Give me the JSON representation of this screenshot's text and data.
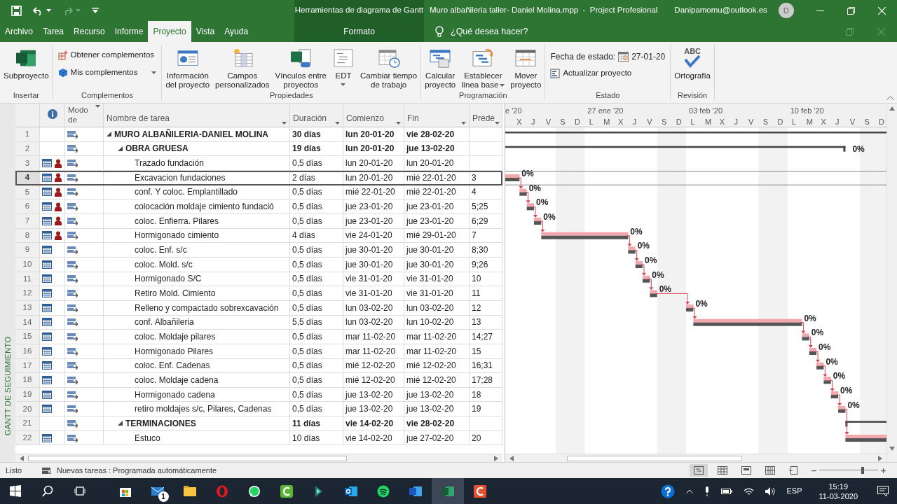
{
  "title_bar": {
    "contextual_title": "Herramientas de diagrama de Gantt",
    "document_title": "Muro albañileria taller- Daniel Molina.mpp  -  Project Profesional",
    "account": "Danipamomu@outlook.es",
    "avatar_initial": "D"
  },
  "ribbon_tabs": [
    {
      "label": "Archivo",
      "selected": false,
      "kind": "normal"
    },
    {
      "label": "Tarea",
      "selected": false,
      "kind": "normal"
    },
    {
      "label": "Recurso",
      "selected": false,
      "kind": "normal"
    },
    {
      "label": "Informe",
      "selected": false,
      "kind": "normal"
    },
    {
      "label": "Proyecto",
      "selected": true,
      "kind": "normal"
    },
    {
      "label": "Vista",
      "selected": false,
      "kind": "normal"
    },
    {
      "label": "Ayuda",
      "selected": false,
      "kind": "normal"
    },
    {
      "label": "Formato",
      "selected": false,
      "kind": "contextual"
    }
  ],
  "tell_me": {
    "placeholder": "¿Qué desea hacer?"
  },
  "ribbon_groups": [
    {
      "label": "Insertar",
      "controls": [
        {
          "kind": "large",
          "label": "Subproyecto",
          "dropdown": false
        }
      ]
    },
    {
      "label": "Complementos",
      "controls": [
        {
          "kind": "small",
          "label": "Obtener complementos",
          "dropdown": false
        },
        {
          "kind": "small",
          "label": "Mis complementos",
          "dropdown": true
        }
      ]
    },
    {
      "label": "Propiedades",
      "controls": [
        {
          "kind": "large",
          "label": "Información\ndel proyecto",
          "dropdown": false
        },
        {
          "kind": "large",
          "label": "Campos\npersonalizados",
          "dropdown": false
        },
        {
          "kind": "large",
          "label": "Vínculos entre\nproyectos",
          "dropdown": false
        },
        {
          "kind": "large",
          "label": "EDT",
          "dropdown": true
        },
        {
          "kind": "large",
          "label": "Cambiar tiempo\nde trabajo",
          "dropdown": false
        }
      ]
    },
    {
      "label": "Programación",
      "controls": [
        {
          "kind": "large",
          "label": "Calcular\nproyecto",
          "dropdown": false
        },
        {
          "kind": "large",
          "label": "Establecer\nlínea base",
          "dropdown": true
        },
        {
          "kind": "large",
          "label": "Mover\nproyecto",
          "dropdown": false
        }
      ]
    },
    {
      "label": "Estado",
      "controls": [
        {
          "kind": "date",
          "label": "Fecha de estado:",
          "value": "27-01-20"
        },
        {
          "kind": "small",
          "label": "Actualizar proyecto",
          "dropdown": false
        }
      ]
    },
    {
      "label": "Revisión",
      "controls": [
        {
          "kind": "large",
          "label": "Ortografía",
          "icon_text": "ABC",
          "dropdown": false
        }
      ]
    }
  ],
  "side_label": "GANTT DE SEGUIMIENTO",
  "table": {
    "columns": [
      {
        "label": "Modo de"
      },
      {
        "label": "Nombre de tarea"
      },
      {
        "label": "Duración"
      },
      {
        "label": "Comienzo"
      },
      {
        "label": "Fin"
      },
      {
        "label": "Prede"
      }
    ],
    "tasks": [
      {
        "id": "1",
        "name": "MURO ALBAÑILERIA-DANIEL MOLINA",
        "duration": "30 días",
        "start": "lun 20-01-20",
        "finish": "vie 28-02-20",
        "calendar_icon": false,
        "person_icon": false,
        "selected": false,
        "expanded": true,
        "children": [
          {
            "id": "2",
            "name": "OBRA GRUESA",
            "duration": "19 días",
            "start": "lun 20-01-20",
            "finish": "jue 13-02-20",
            "percent": "0%",
            "calendar_icon": false,
            "person_icon": false,
            "selected": false,
            "expanded": true,
            "children": [
              {
                "id": "3",
                "name": "Trazado fundación",
                "duration": "0,5 días",
                "start": "lun 20-01-20",
                "finish": "lun 20-01-20",
                "calendar_icon": true,
                "person_icon": true,
                "selected": false
              },
              {
                "id": "4",
                "name": "Excavacion fundaciones",
                "duration": "2 días",
                "start": "lun 20-01-20",
                "finish": "mié 22-01-20",
                "predecessors": "3",
                "percent": "0%",
                "calendar_icon": true,
                "person_icon": true,
                "selected": true
              },
              {
                "id": "5",
                "name": "conf. Y coloc. Emplantillado",
                "duration": "0,5 días",
                "start": "mié 22-01-20",
                "finish": "mié 22-01-20",
                "predecessors": "4",
                "percent": "0%",
                "calendar_icon": true,
                "person_icon": true,
                "selected": false
              },
              {
                "id": "6",
                "name": "colocación moldaje cimiento fundació",
                "duration": "0,5 días",
                "start": "jue 23-01-20",
                "finish": "jue 23-01-20",
                "predecessors": "5;25",
                "percent": "0%",
                "calendar_icon": true,
                "person_icon": true,
                "selected": false
              },
              {
                "id": "7",
                "name": "coloc. Enfierra. Pilares",
                "duration": "0,5 días",
                "start": "jue 23-01-20",
                "finish": "jue 23-01-20",
                "predecessors": "6;29",
                "percent": "0%",
                "calendar_icon": true,
                "person_icon": true,
                "selected": false
              },
              {
                "id": "8",
                "name": "Hormigonado cimiento",
                "duration": "4 días",
                "start": "vie 24-01-20",
                "finish": "mié 29-01-20",
                "predecessors": "7",
                "percent": "0%",
                "calendar_icon": true,
                "person_icon": true,
                "selected": false
              },
              {
                "id": "9",
                "name": "coloc. Enf. s/c",
                "duration": "0,5 días",
                "start": "jue 30-01-20",
                "finish": "jue 30-01-20",
                "predecessors": "8;30",
                "percent": "0%",
                "calendar_icon": true,
                "person_icon": false,
                "selected": false
              },
              {
                "id": "10",
                "name": "coloc. Mold. s/c",
                "duration": "0,5 días",
                "start": "jue 30-01-20",
                "finish": "jue 30-01-20",
                "predecessors": "9;26",
                "percent": "0%",
                "calendar_icon": true,
                "person_icon": false,
                "selected": false
              },
              {
                "id": "11",
                "name": "Hormigonado S/C",
                "duration": "0,5 días",
                "start": "vie 31-01-20",
                "finish": "vie 31-01-20",
                "predecessors": "10",
                "percent": "0%",
                "calendar_icon": true,
                "person_icon": false,
                "selected": false
              },
              {
                "id": "12",
                "name": "Retiro Mold. Cimiento",
                "duration": "0,5 días",
                "start": "vie 31-01-20",
                "finish": "vie 31-01-20",
                "predecessors": "11",
                "percent": "0%",
                "calendar_icon": true,
                "person_icon": false,
                "selected": false
              },
              {
                "id": "13",
                "name": "Relleno y compactado sobrexcavación",
                "duration": "0,5 días",
                "start": "lun 03-02-20",
                "finish": "lun 03-02-20",
                "predecessors": "12",
                "percent": "0%",
                "calendar_icon": true,
                "person_icon": false,
                "selected": false
              },
              {
                "id": "14",
                "name": "conf. Albañileria",
                "duration": "5,5 días",
                "start": "lun 03-02-20",
                "finish": "lun 10-02-20",
                "predecessors": "13",
                "percent": "0%",
                "calendar_icon": true,
                "person_icon": false,
                "selected": false
              },
              {
                "id": "15",
                "name": "coloc. Moldaje pilares",
                "duration": "0,5 días",
                "start": "mar 11-02-20",
                "finish": "mar 11-02-20",
                "predecessors": "14;27",
                "percent": "0%",
                "calendar_icon": true,
                "person_icon": false,
                "selected": false
              },
              {
                "id": "16",
                "name": "Hormigonado Pilares",
                "duration": "0,5 días",
                "start": "mar 11-02-20",
                "finish": "mar 11-02-20",
                "predecessors": "15",
                "percent": "0%",
                "calendar_icon": true,
                "person_icon": false,
                "selected": false
              },
              {
                "id": "17",
                "name": "coloc. Enf. Cadenas",
                "duration": "0,5 días",
                "start": "mié 12-02-20",
                "finish": "mié 12-02-20",
                "predecessors": "16;31",
                "percent": "0%",
                "calendar_icon": true,
                "person_icon": false,
                "selected": false
              },
              {
                "id": "18",
                "name": "coloc. Moldaje cadena",
                "duration": "0,5 días",
                "start": "mié 12-02-20",
                "finish": "mié 12-02-20",
                "predecessors": "17;28",
                "percent": "0%",
                "calendar_icon": true,
                "person_icon": false,
                "selected": false
              },
              {
                "id": "19",
                "name": "Hormigonado cadena",
                "duration": "0,5 días",
                "start": "jue 13-02-20",
                "finish": "jue 13-02-20",
                "predecessors": "18",
                "percent": "0%",
                "calendar_icon": true,
                "person_icon": false,
                "selected": false
              },
              {
                "id": "20",
                "name": "retiro moldajes s/c, Pilares, Cadenas",
                "duration": "0,5 días",
                "start": "jue 13-02-20",
                "finish": "jue 13-02-20",
                "predecessors": "19",
                "percent": "0%",
                "calendar_icon": true,
                "person_icon": false,
                "selected": false
              }
            ]
          },
          {
            "id": "21",
            "name": "TERMINACIONES",
            "duration": "11 días",
            "start": "vie 14-02-20",
            "finish": "vie 28-02-20",
            "calendar_icon": false,
            "person_icon": false,
            "selected": false,
            "expanded": true,
            "children": [
              {
                "id": "22",
                "name": "Estuco",
                "duration": "10 días",
                "start": "vie 14-02-20",
                "finish": "jue 27-02-20",
                "predecessors": "20",
                "calendar_icon": true,
                "person_icon": false,
                "selected": false
              }
            ]
          }
        ]
      }
    ]
  },
  "timeline": {
    "weeks": [
      "e '20",
      "27 ene '20",
      "03 feb '20",
      "10 feb '20"
    ],
    "days": [
      {
        "label": "X",
        "nonworking": false
      },
      {
        "label": "J",
        "nonworking": false
      },
      {
        "label": "V",
        "nonworking": false
      },
      {
        "label": "S",
        "nonworking": true
      },
      {
        "label": "D",
        "nonworking": true
      },
      {
        "label": "L",
        "nonworking": false
      },
      {
        "label": "M",
        "nonworking": false
      },
      {
        "label": "X",
        "nonworking": false
      },
      {
        "label": "J",
        "nonworking": false
      },
      {
        "label": "V",
        "nonworking": false
      },
      {
        "label": "S",
        "nonworking": true
      },
      {
        "label": "D",
        "nonworking": true
      },
      {
        "label": "L",
        "nonworking": false
      },
      {
        "label": "M",
        "nonworking": false
      },
      {
        "label": "X",
        "nonworking": false
      },
      {
        "label": "J",
        "nonworking": false
      },
      {
        "label": "V",
        "nonworking": false
      },
      {
        "label": "S",
        "nonworking": true
      },
      {
        "label": "D",
        "nonworking": true
      },
      {
        "label": "L",
        "nonworking": false
      },
      {
        "label": "M",
        "nonworking": false
      },
      {
        "label": "X",
        "nonworking": false
      },
      {
        "label": "J",
        "nonworking": false
      },
      {
        "label": "V",
        "nonworking": false
      },
      {
        "label": "S",
        "nonworking": true
      },
      {
        "label": "D",
        "nonworking": true
      }
    ]
  },
  "status_bar": {
    "text": "Listo",
    "new_tasks": "Nuevas tareas : Programada automáticamente",
    "views": [
      {
        "selected": true
      },
      {
        "selected": false
      },
      {
        "selected": false
      },
      {
        "selected": false
      },
      {
        "selected": false
      }
    ],
    "zoom": {
      "level": 0.74
    }
  },
  "taskbar": {
    "apps": [
      {
        "selected": false
      },
      {
        "selected": false
      },
      {
        "selected": false
      },
      {
        "selected": false
      },
      {
        "selected": false
      },
      {
        "selected": false
      },
      {
        "selected": false
      },
      {
        "selected": false
      },
      {
        "selected": false
      },
      {
        "selected": false
      },
      {
        "selected": false
      },
      {
        "selected": false
      },
      {
        "selected": false
      },
      {
        "selected": true
      },
      {
        "selected": false
      }
    ],
    "mail_badge": "1",
    "language": "ESP",
    "time": "15:19",
    "date": "11-03-2020"
  }
}
